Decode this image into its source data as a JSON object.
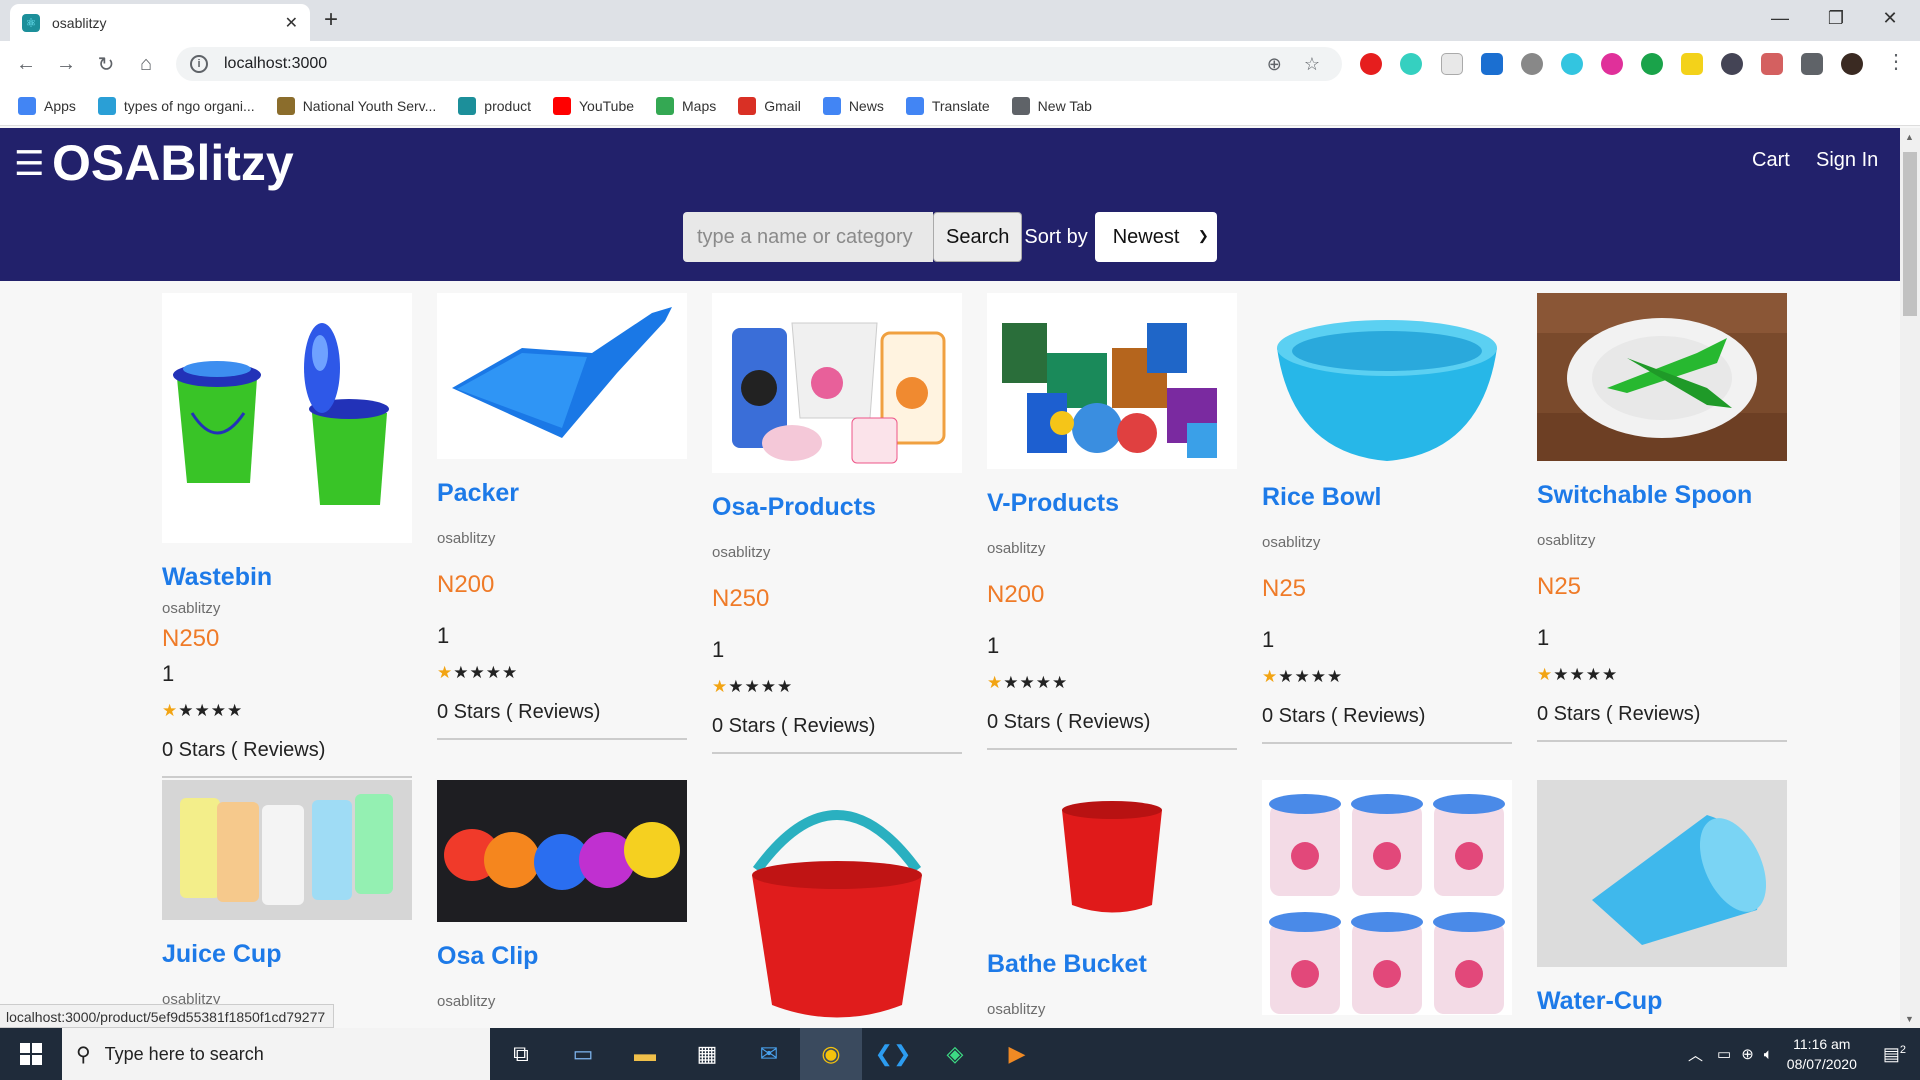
{
  "browser": {
    "tab_title": "osablitzy",
    "url": "localhost:3000",
    "status_url": "localhost:3000/product/5ef9d55381f1850f1cd79277",
    "bookmarks": [
      {
        "label": "Apps",
        "icon": "apps-grid-icon",
        "color": "#4285f4"
      },
      {
        "label": "types of ngo organi...",
        "icon": "ngo-icon",
        "color": "#2a9fd6"
      },
      {
        "label": "National Youth Serv...",
        "icon": "nysc-icon",
        "color": "#8b6d2c"
      },
      {
        "label": "product",
        "icon": "react-icon",
        "color": "#1c8f9a"
      },
      {
        "label": "YouTube",
        "icon": "youtube-icon",
        "color": "#ff0000"
      },
      {
        "label": "Maps",
        "icon": "maps-icon",
        "color": "#34a853"
      },
      {
        "label": "Gmail",
        "icon": "gmail-icon",
        "color": "#d93025"
      },
      {
        "label": "News",
        "icon": "news-icon",
        "color": "#4285f4"
      },
      {
        "label": "Translate",
        "icon": "translate-icon",
        "color": "#4285f4"
      },
      {
        "label": "New Tab",
        "icon": "globe-icon",
        "color": "#5f6368"
      }
    ]
  },
  "header": {
    "brand": "OSABlitzy",
    "cart": "Cart",
    "signin": "Sign In",
    "search_placeholder": "type a name or category",
    "search_button": "Search",
    "sort_label": "Sort by",
    "sort_value": "Newest",
    "bg_color": "#22216b"
  },
  "products": [
    {
      "name": "Wastebin",
      "brand": "osablitzy",
      "price": "N250",
      "count": "1",
      "rating_text": "0 Stars ( Reviews)",
      "stars": 1
    },
    {
      "name": "Packer",
      "brand": "osablitzy",
      "price": "N200",
      "count": "1",
      "rating_text": "0 Stars ( Reviews)",
      "stars": 1
    },
    {
      "name": "Osa-Products",
      "brand": "osablitzy",
      "price": "N250",
      "count": "1",
      "rating_text": "0 Stars ( Reviews)",
      "stars": 1
    },
    {
      "name": "V-Products",
      "brand": "osablitzy",
      "price": "N200",
      "count": "1",
      "rating_text": "0 Stars ( Reviews)",
      "stars": 1
    },
    {
      "name": "Rice Bowl",
      "brand": "osablitzy",
      "price": "N25",
      "count": "1",
      "rating_text": "0 Stars ( Reviews)",
      "stars": 1
    },
    {
      "name": "Switchable Spoon",
      "brand": "osablitzy",
      "price": "N25",
      "count": "1",
      "rating_text": "0 Stars ( Reviews)",
      "stars": 1
    },
    {
      "name": "Juice Cup",
      "brand": "osablitzy"
    },
    {
      "name": "Osa Clip",
      "brand": "osablitzy"
    },
    {
      "name": "",
      "brand": ""
    },
    {
      "name": "Bathe Bucket",
      "brand": "osablitzy"
    },
    {
      "name": "",
      "brand": ""
    },
    {
      "name": "Water-Cup",
      "brand": ""
    }
  ],
  "taskbar": {
    "search_placeholder": "Type here to search",
    "time": "11:16 am",
    "date": "08/07/2020",
    "notifications": "2"
  }
}
